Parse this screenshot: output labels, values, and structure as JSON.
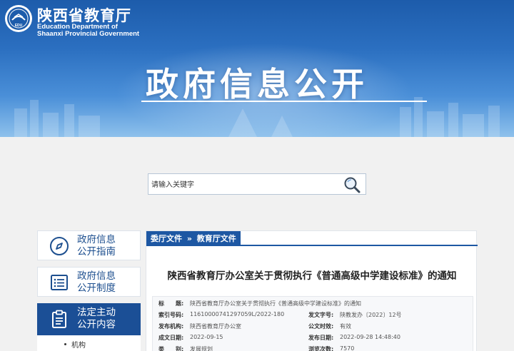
{
  "header": {
    "org_cn": "陕西省教育厅",
    "org_en_line1": "Education Department of",
    "org_en_line2": "Shaanxi Provincial Government",
    "logo_text": "EDU",
    "hero_title": "政府信息公开"
  },
  "search": {
    "placeholder": "请输入关键字",
    "icon": "search-icon"
  },
  "sidebar": {
    "items": [
      {
        "line1": "政府信息",
        "line2": "公开指南",
        "icon": "compass-icon"
      },
      {
        "line1": "政府信息",
        "line2": "公开制度",
        "icon": "list-icon"
      },
      {
        "line1": "法定主动",
        "line2": "公开内容",
        "icon": "document-icon"
      }
    ],
    "sub_items": [
      "机构"
    ]
  },
  "breadcrumb": {
    "part1": "委厅文件",
    "separator": "»",
    "part2": "教育厅文件"
  },
  "document": {
    "title": "陕西省教育厅办公室关于贯彻执行《普通高级中学建设标准》的通知",
    "meta": {
      "title_label": "标　　题:",
      "title_value": "陕西省教育厅办公室关于贯彻执行《普通高级中学建设标准》的通知",
      "index_label": "索引号码:",
      "index_value": "11610000741297059L/2022-180",
      "docno_label": "发文字号:",
      "docno_value": "陕教发办〔2022〕12号",
      "org_label": "发布机构:",
      "org_value": "陕西省教育厅办公室",
      "validity_label": "公文时效:",
      "validity_value": "有效",
      "created_label": "成文日期:",
      "created_value": "2022-09-15",
      "published_label": "发布日期:",
      "published_value": "2022-09-28 14:48:40",
      "category_label": "类　　别:",
      "category_value": "发展规划",
      "views_label": "浏览次数:",
      "views_value": "7570"
    }
  },
  "colors": {
    "brand_blue": "#1d57a3",
    "active_blue": "#1b4f96",
    "banner_top": "#1d5cab"
  }
}
